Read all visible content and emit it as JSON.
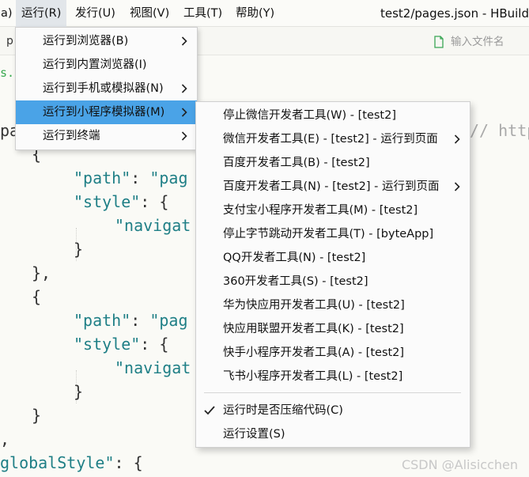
{
  "menubar": {
    "items": [
      {
        "label": "a)"
      },
      {
        "label": "运行(R)"
      },
      {
        "label": "发行(U)"
      },
      {
        "label": "视图(V)"
      },
      {
        "label": "工具(T)"
      },
      {
        "label": "帮助(Y)"
      }
    ],
    "window_title": "test2/pages.json - HBuild"
  },
  "tabbar": {
    "tab_label": "p",
    "search_placeholder": "输入文件名"
  },
  "editor": {
    "file_fragment": "s.js",
    "comment_fragment": "// https",
    "tokens": {
      "pa": "pa",
      "path_key": "\"path\"",
      "style_key": "\"style\"",
      "pag": "\"pag",
      "navigat": "\"navigat",
      "global_style": "globalStyle\"",
      "colon": ":",
      "open_brace": "{",
      "close_brace": "}",
      "close_brace_comma": "},",
      "comma": ","
    }
  },
  "run_menu": {
    "items": [
      {
        "label": "运行到浏览器(B)",
        "has_submenu": true
      },
      {
        "label": "运行到内置浏览器(I)",
        "has_submenu": false
      },
      {
        "label": "运行到手机或模拟器(N)",
        "has_submenu": true
      },
      {
        "label": "运行到小程序模拟器(M)",
        "has_submenu": true,
        "highlighted": true
      },
      {
        "label": "运行到终端",
        "has_submenu": true
      }
    ]
  },
  "miniprogram_submenu": {
    "items": [
      {
        "label": "停止微信开发者工具(W) - [test2]",
        "has_submenu": false
      },
      {
        "label": "微信开发者工具(E) - [test2] - 运行到页面",
        "has_submenu": true
      },
      {
        "label": "百度开发者工具(B) - [test2]",
        "has_submenu": false
      },
      {
        "label": "百度开发者工具(N) - [test2] - 运行到页面",
        "has_submenu": true
      },
      {
        "label": "支付宝小程序开发者工具(M) - [test2]",
        "has_submenu": false
      },
      {
        "label": "停止字节跳动开发者工具(T) - [byteApp]",
        "has_submenu": false
      },
      {
        "label": "QQ开发者工具(N) - [test2]",
        "has_submenu": false
      },
      {
        "label": "360开发者工具(S) - [test2]",
        "has_submenu": false
      },
      {
        "label": "华为快应用开发者工具(U) - [test2]",
        "has_submenu": false
      },
      {
        "label": "快应用联盟开发者工具(K) - [test2]",
        "has_submenu": false
      },
      {
        "label": "快手小程序开发者工具(A) - [test2]",
        "has_submenu": false
      },
      {
        "label": "飞书小程序开发者工具(L) - [test2]",
        "has_submenu": false
      }
    ],
    "options": [
      {
        "label": "运行时是否压缩代码(C)",
        "checked": true
      },
      {
        "label": "运行设置(S)",
        "checked": false
      }
    ]
  },
  "watermark": "CSDN @Alisicchen",
  "colors": {
    "highlight": "#4aa3e7",
    "code_teal": "#1f7f86",
    "file_green": "#38a84f"
  }
}
